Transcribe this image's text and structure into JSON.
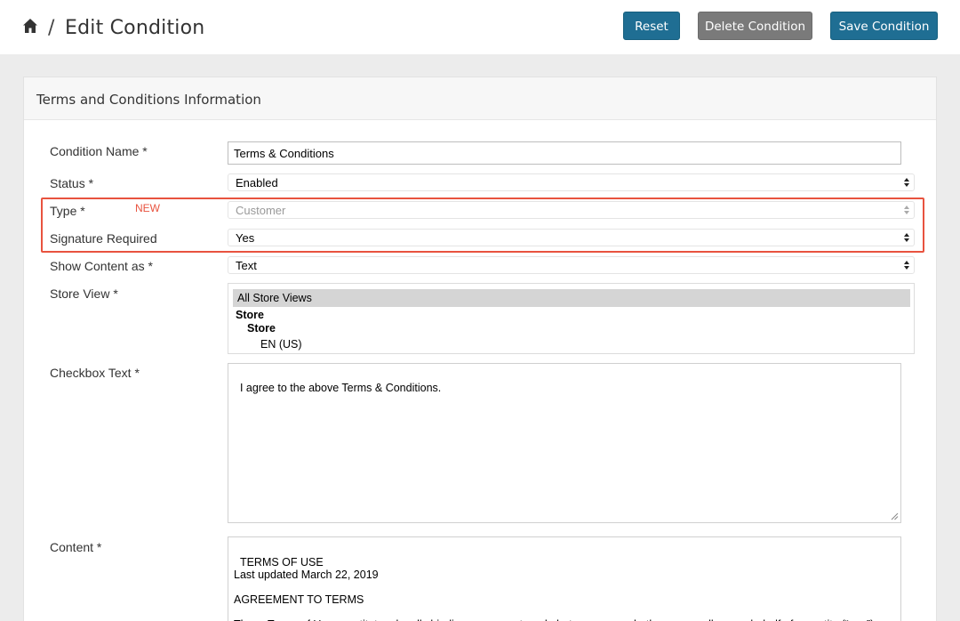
{
  "header": {
    "breadcrumb_sep": "/",
    "title": "Edit Condition",
    "buttons": {
      "reset": "Reset",
      "delete": "Delete Condition",
      "save": "Save Condition"
    }
  },
  "panel": {
    "title": "Terms and Conditions Information"
  },
  "form": {
    "condition_name": {
      "label": "Condition Name *",
      "value": "Terms & Conditions"
    },
    "status": {
      "label": "Status *",
      "value": "Enabled"
    },
    "type": {
      "label": "Type *",
      "value": "Customer",
      "badge": "NEW"
    },
    "signature_required": {
      "label": "Signature Required",
      "value": "Yes"
    },
    "show_content_as": {
      "label": "Show Content as *",
      "value": "Text"
    },
    "store_view": {
      "label": "Store View *",
      "options": [
        "All Store Views",
        "Store",
        "Store",
        "EN (US)"
      ]
    },
    "checkbox_text": {
      "label": "Checkbox Text *",
      "value": "I agree to the above Terms & Conditions."
    },
    "content": {
      "label": "Content *",
      "value": "TERMS OF USE\nLast updated March 22, 2019\n\nAGREEMENT TO TERMS\n\nThese Terms of Use constitute a legally binding agreement made between you, whether personally or on behalf of an entity (“you”) and"
    }
  },
  "colors": {
    "primary": "#1f6e93",
    "secondary": "#7a7a7a",
    "highlight": "#e8533f"
  }
}
